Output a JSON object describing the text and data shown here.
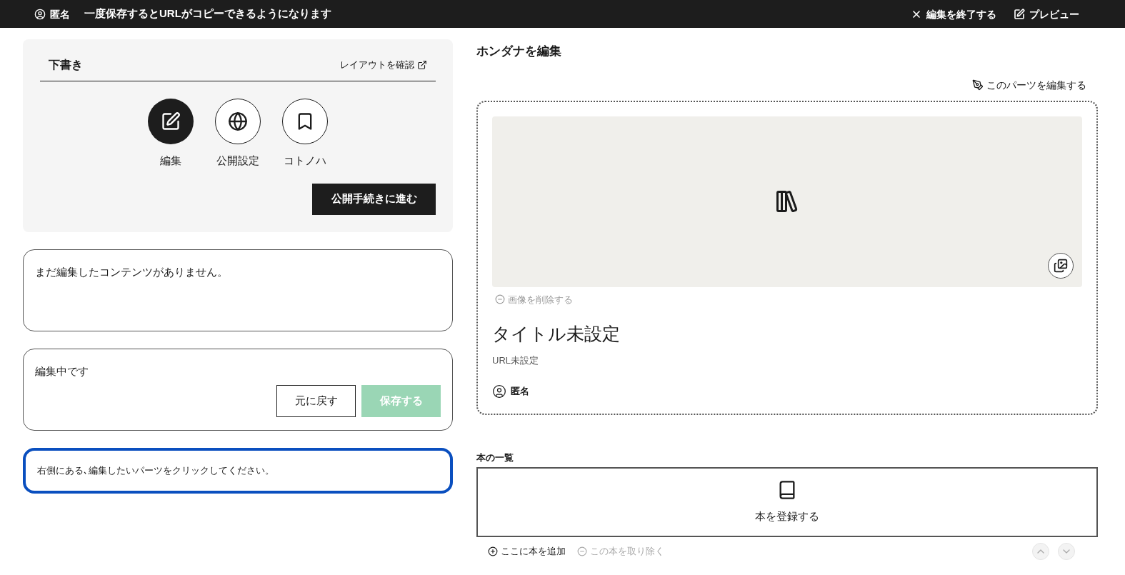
{
  "top_bar": {
    "user": "匿名",
    "notice": "一度保存するとURLがコピーできるようになります",
    "actions": [
      {
        "kind": "close",
        "label": "編集を終了する"
      },
      {
        "kind": "preview",
        "label": "プレビュー"
      }
    ]
  },
  "draft_panel": {
    "title": "下書き",
    "layout_link": "レイアウトを確認",
    "tools": [
      {
        "kind": "edit",
        "label": "編集",
        "selected": true
      },
      {
        "kind": "publish",
        "label": "公開設定",
        "selected": false
      },
      {
        "kind": "bookmark",
        "label": "コトノハ",
        "selected": false
      }
    ],
    "proceed_button": "公開手続きに進む"
  },
  "content_notice": "まだ編集したコンテンツがありません。",
  "edit_status": {
    "message": "編集中です",
    "revert_button": "元に戻す",
    "save_button": {
      "label": "保存する",
      "disabled": true
    }
  },
  "hint": "右側にある､編集したいパーツをクリックしてください。",
  "editor": {
    "title": "ホンダナを編集",
    "edit_part_link": "このパーツを編集する",
    "cover": {
      "remove_image": {
        "label": "画像を削除する",
        "disabled": true
      }
    },
    "shelf_title": "タイトル未設定",
    "url": "URL未設定",
    "owner": "匿名"
  },
  "book_list": {
    "heading": "本の一覧",
    "register_label": "本を登録する",
    "add_here": "ここに本を追加",
    "remove_book": {
      "label": "この本を取り除く",
      "disabled": true
    },
    "move_up_disabled": true,
    "move_down_disabled": true
  }
}
